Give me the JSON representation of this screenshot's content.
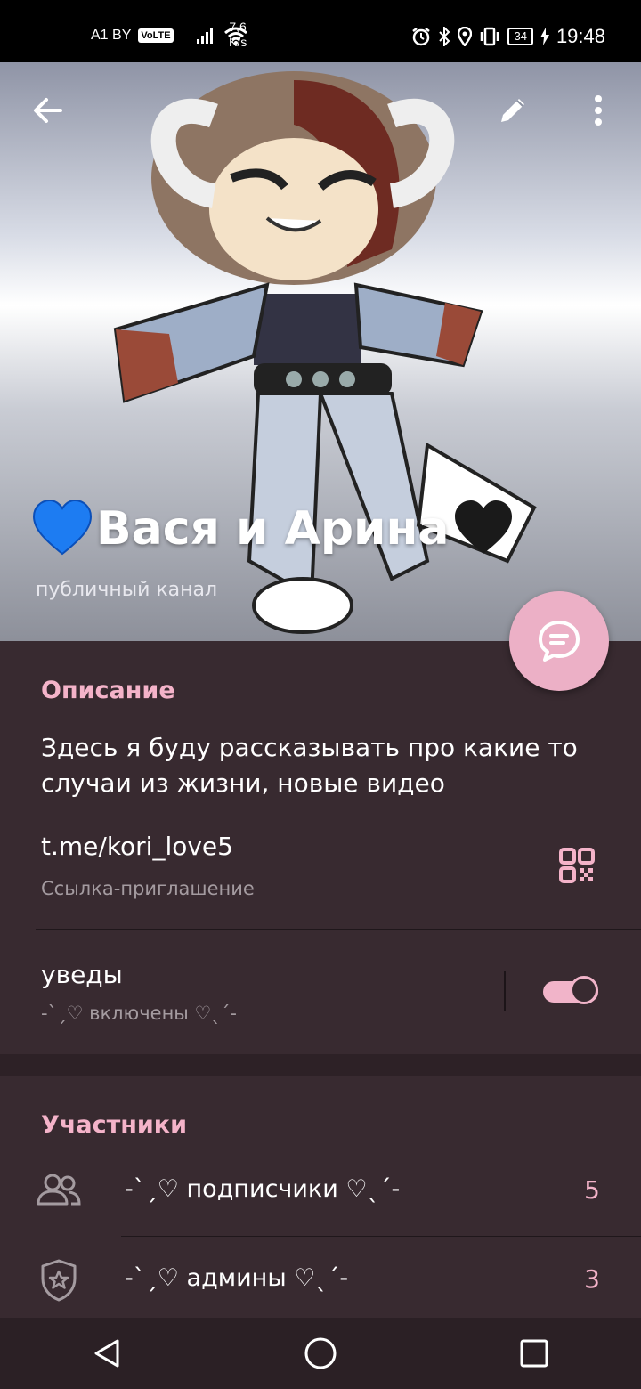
{
  "status_bar": {
    "carrier": "A1 BY",
    "volte": "VoLTE",
    "speed_value": "7,6",
    "speed_unit": "K/s",
    "battery": "34",
    "time": "19:48"
  },
  "header": {
    "channel_name": "Вася и Арина",
    "channel_type": "публичный канал"
  },
  "description_section": {
    "title": "Описание",
    "text": "Здесь я буду рассказывать про какие то случаи из жизни, новые видео",
    "link": "t.me/kori_love5",
    "link_label": "Ссылка-приглашение"
  },
  "notifications": {
    "label": "уведы",
    "status": "-ˋˏ♡ включены ♡ˎˊ-",
    "enabled": true
  },
  "members_section": {
    "title": "Участники",
    "items": [
      {
        "icon": "people-icon",
        "label": "-ˋˏ♡ подписчики ♡ˎˊ-",
        "count": "5"
      },
      {
        "icon": "shield-star-icon",
        "label": "-ˋˏ♡ админы ♡ˎˊ-",
        "count": "3"
      }
    ]
  },
  "colors": {
    "accent": "#f4b3c9",
    "background": "#382a30",
    "fab": "#ecb0c6"
  }
}
